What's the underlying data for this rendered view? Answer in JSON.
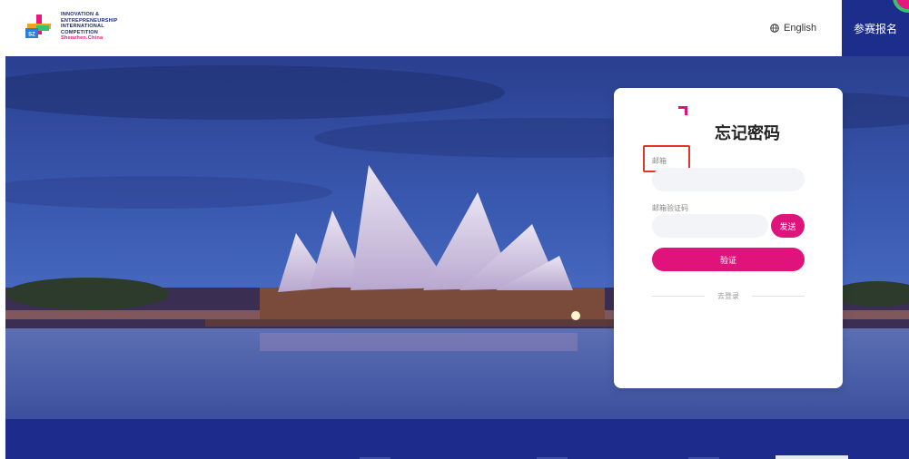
{
  "header": {
    "logo": {
      "lines": [
        "INNOVATION &",
        "ENTREPRENEURSHIP",
        "INTERNATIONAL",
        "COMPETITION"
      ],
      "city": "Shenzhen.China",
      "badge": "SZ"
    },
    "language_label": "English",
    "register_label": "参赛报名"
  },
  "card": {
    "title": "忘记密码",
    "email_label": "邮箱",
    "email_value": "",
    "code_label": "邮箱验证码",
    "code_value": "",
    "send_label": "发送",
    "verify_label": "验证",
    "login_link": "去登录"
  },
  "colors": {
    "brand_navy": "#1c2d8c",
    "brand_pink": "#e0137c",
    "highlight_red": "#e2342c"
  }
}
